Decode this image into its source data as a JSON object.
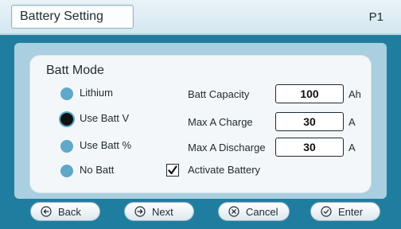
{
  "header": {
    "title": "Battery Setting",
    "page": "P1"
  },
  "panel": {
    "title": "Batt Mode"
  },
  "modes": [
    {
      "label": "Lithium",
      "selected": false
    },
    {
      "label": "Use Batt V",
      "selected": true
    },
    {
      "label": "Use Batt %",
      "selected": false
    },
    {
      "label": "No Batt",
      "selected": false
    }
  ],
  "fields": [
    {
      "label": "Batt Capacity",
      "value": "100",
      "unit": "Ah"
    },
    {
      "label": "Max A Charge",
      "value": "30",
      "unit": "A"
    },
    {
      "label": "Max A Discharge",
      "value": "30",
      "unit": "A"
    }
  ],
  "activate": {
    "label": "Activate Battery",
    "checked": true
  },
  "buttons": {
    "back": "Back",
    "next": "Next",
    "cancel": "Cancel",
    "enter": "Enter"
  },
  "colors": {
    "background": "#1f7e9f",
    "radio": "#5fa8c8",
    "panel": "#f3f7f9"
  }
}
